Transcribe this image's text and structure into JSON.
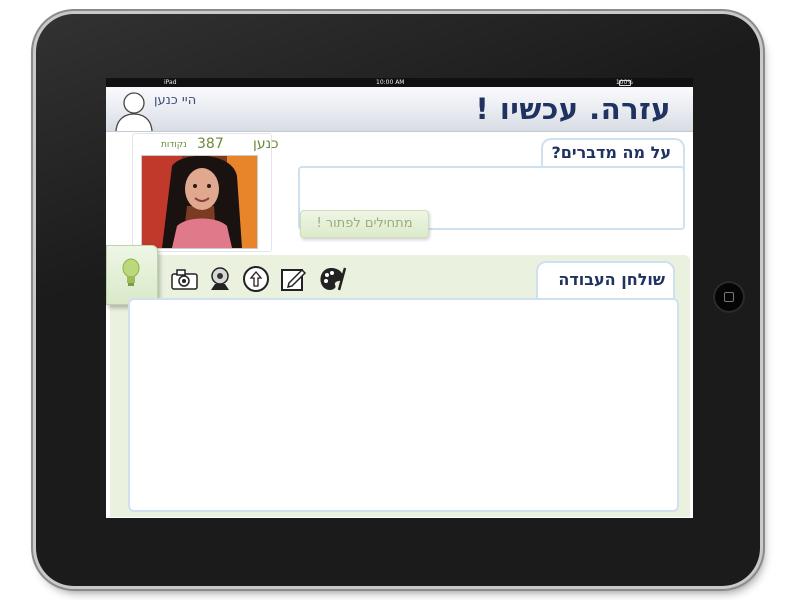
{
  "status_bar": {
    "left": "iPad",
    "time": "10:00 AM",
    "battery": "100%"
  },
  "header": {
    "title": "עזרה. עכשיו !",
    "greeting": "היי כנען"
  },
  "profile": {
    "name": "כנען",
    "points": "387",
    "points_label": "נקודות"
  },
  "question": {
    "label": "על מה מדברים?",
    "input_value": "",
    "start_button": "מתחילים לפתור !"
  },
  "workspace": {
    "label": "שולחן העבודה",
    "tools": [
      "camera-icon",
      "webcam-icon",
      "upload-icon",
      "edit-icon",
      "palette-icon"
    ]
  },
  "colors": {
    "title": "#1f3260",
    "accent_green": "#6b8a3a",
    "panel_green": "#eaf2df",
    "border_blue": "#cfe0ee"
  }
}
